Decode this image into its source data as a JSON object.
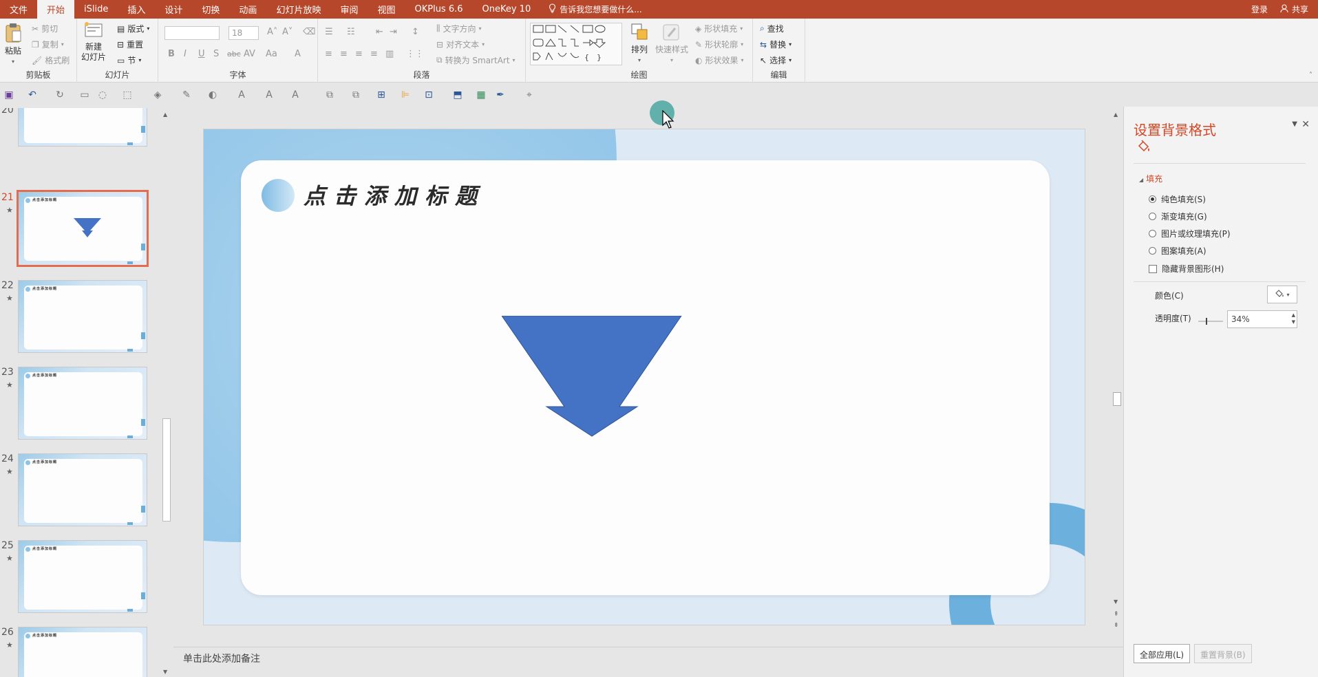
{
  "menu": {
    "tabs": [
      "文件",
      "开始",
      "iSlide",
      "插入",
      "设计",
      "切换",
      "动画",
      "幻灯片放映",
      "审阅",
      "视图",
      "OKPlus 6.6",
      "OneKey 10"
    ],
    "active_index": 1,
    "tell_me": "告诉我您想要做什么...",
    "login": "登录",
    "share": "共享"
  },
  "ribbon": {
    "clipboard": {
      "paste": "粘贴",
      "cut": "剪切",
      "copy": "复制",
      "format_painter": "格式刷",
      "label": "剪贴板"
    },
    "slides": {
      "new_slide_1": "新建",
      "new_slide_2": "幻灯片",
      "layout": "版式",
      "reset": "重置",
      "section": "节",
      "label": "幻灯片"
    },
    "font": {
      "size": "18",
      "label": "字体"
    },
    "paragraph": {
      "text_direction": "文字方向",
      "align_text": "对齐文本",
      "convert_smartart": "转换为 SmartArt",
      "label": "段落"
    },
    "drawing": {
      "arrange": "排列",
      "quick_styles": "快速样式",
      "shape_fill": "形状填充",
      "shape_outline": "形状轮廓",
      "shape_effects": "形状效果",
      "label": "绘图"
    },
    "editing": {
      "find": "查找",
      "replace": "替换",
      "select": "选择",
      "label": "编辑"
    }
  },
  "thumbnails": [
    {
      "num": "20",
      "selected": false
    },
    {
      "num": "21",
      "selected": true
    },
    {
      "num": "22",
      "selected": false
    },
    {
      "num": "23",
      "selected": false
    },
    {
      "num": "24",
      "selected": false
    },
    {
      "num": "25",
      "selected": false
    },
    {
      "num": "26",
      "selected": false
    }
  ],
  "slide": {
    "title": "点击添加标题",
    "arrow_color": "#4472c4"
  },
  "notes_placeholder": "单击此处添加备注",
  "format_pane": {
    "title": "设置背景格式",
    "section": "填充",
    "options": [
      "纯色填充(S)",
      "渐变填充(G)",
      "图片或纹理填充(P)",
      "图案填充(A)"
    ],
    "selected_option": 0,
    "hide_background": "隐藏背景图形(H)",
    "color_label": "颜色(C)",
    "transparency_label": "透明度(T)",
    "transparency_value": "34%",
    "apply_all": "全部应用(L)",
    "reset_background": "重置背景(B)"
  },
  "colors": {
    "accent": "#b7472a",
    "pane_title": "#d24726"
  }
}
